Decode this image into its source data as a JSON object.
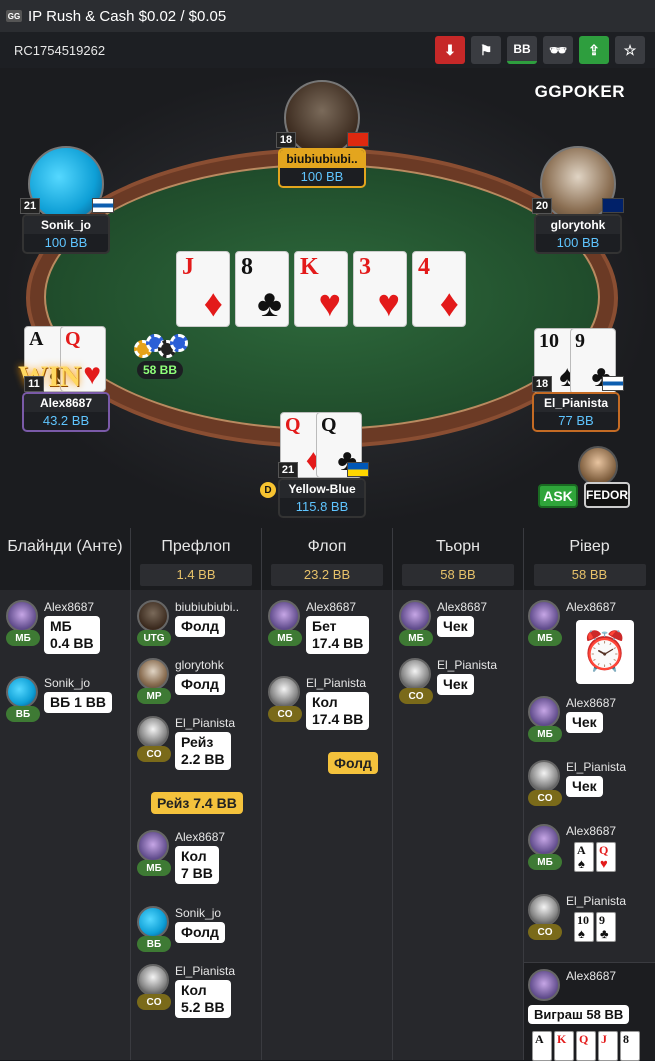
{
  "title": "IP  Rush & Cash $0.02 / $0.05",
  "app_icon": "GG",
  "hand_id": "RC1754519262",
  "toolbar": {
    "bb_label": "BB",
    "icons": [
      "download-icon",
      "report-icon",
      "bb-toggle-icon",
      "incognito-icon",
      "share-icon",
      "star-icon"
    ],
    "colors": {
      "download": "#c62828",
      "share": "#2e9e3e",
      "gray": "#3a3c41"
    }
  },
  "logo": "GGPOKER",
  "board": [
    {
      "rank": "J",
      "suit": "♦",
      "color": "red"
    },
    {
      "rank": "8",
      "suit": "♣",
      "color": "black"
    },
    {
      "rank": "K",
      "suit": "♥",
      "color": "red"
    },
    {
      "rank": "3",
      "suit": "♥",
      "color": "red"
    },
    {
      "rank": "4",
      "suit": "♦",
      "color": "red"
    }
  ],
  "pot_chips": "58 BB",
  "win_label": "WIN",
  "seats": {
    "top": {
      "name": "biubiubiubi..",
      "stack": "100 BB",
      "level": "18"
    },
    "left_top": {
      "name": "Sonik_jo",
      "stack": "100 BB",
      "level": "21"
    },
    "right_top": {
      "name": "glorytohk",
      "stack": "100 BB",
      "level": "20"
    },
    "left_mid": {
      "name": "Alex8687",
      "stack": "43.2 BB",
      "level": "11",
      "cards": [
        {
          "rank": "A",
          "suit": "♠"
        },
        {
          "rank": "Q",
          "suit": "♥"
        }
      ]
    },
    "right_mid": {
      "name": "El_Pianista",
      "stack": "77 BB",
      "level": "18",
      "cards": [
        {
          "rank": "10",
          "suit": "♠"
        },
        {
          "rank": "9",
          "suit": "♣"
        }
      ]
    },
    "bottom": {
      "name": "Yellow-Blue",
      "stack": "115.8 BB",
      "level": "21",
      "cards": [
        {
          "rank": "Q",
          "suit": "♦"
        },
        {
          "rank": "Q",
          "suit": "♣"
        }
      ],
      "dealer": "D"
    }
  },
  "ask": "ASK",
  "fedor": "FEDOR",
  "history": {
    "columns": [
      {
        "title": "Блайнди (Анте)",
        "pot": ""
      },
      {
        "title": "Префлоп",
        "pot": "1.4 BB"
      },
      {
        "title": "Флоп",
        "pot": "23.2 BB"
      },
      {
        "title": "Тьорн",
        "pot": "58 BB"
      },
      {
        "title": "Рівер",
        "pot": "58 BB"
      }
    ],
    "blinds": [
      {
        "player": "Alex8687",
        "pos": "МБ",
        "action": "МБ\n0.4 BB"
      },
      {
        "player": "Sonik_jo",
        "pos": "ВБ",
        "action": "ВБ 1 BB"
      }
    ],
    "preflop": [
      {
        "player": "biubiubiubi..",
        "pos": "UTG",
        "action": "Фолд"
      },
      {
        "player": "glorytohk",
        "pos": "MP",
        "action": "Фолд"
      },
      {
        "player": "El_Pianista",
        "pos": "CO",
        "action": "Рейз\n2.2 BB"
      },
      {
        "raise_pill": "Рейз 7.4 BB"
      },
      {
        "player": "Alex8687",
        "pos": "МБ",
        "action": "Кол\n7 BB"
      },
      {
        "player": "Sonik_jo",
        "pos": "ВБ",
        "action": "Фолд"
      },
      {
        "player": "El_Pianista",
        "pos": "CO",
        "action": "Кол\n5.2 BB"
      }
    ],
    "flop": [
      {
        "player": "Alex8687",
        "pos": "МБ",
        "action": "Бет\n17.4 BB"
      },
      {
        "player": "El_Pianista",
        "pos": "CO",
        "action": "Кол\n17.4 BB"
      },
      {
        "fold_pill": "Фолд"
      }
    ],
    "turn": [
      {
        "player": "Alex8687",
        "pos": "МБ",
        "action": "Чек"
      },
      {
        "player": "El_Pianista",
        "pos": "CO",
        "action": "Чек"
      }
    ],
    "river": [
      {
        "player": "Alex8687",
        "pos": "МБ",
        "action": "clock-icon"
      },
      {
        "player": "Alex8687",
        "pos": "МБ",
        "action": "Чек"
      },
      {
        "player": "El_Pianista",
        "pos": "CO",
        "action": "Чек"
      },
      {
        "player": "Alex8687",
        "pos": "МБ",
        "cards": [
          "A♠",
          "Q♥"
        ]
      },
      {
        "player": "El_Pianista",
        "pos": "CO",
        "cards": [
          "10♠",
          "9♣"
        ]
      }
    ],
    "winner": {
      "player": "Alex8687",
      "label": "Виграш 58 BB",
      "cards": [
        "A",
        "K",
        "Q",
        "J",
        "8"
      ]
    }
  }
}
